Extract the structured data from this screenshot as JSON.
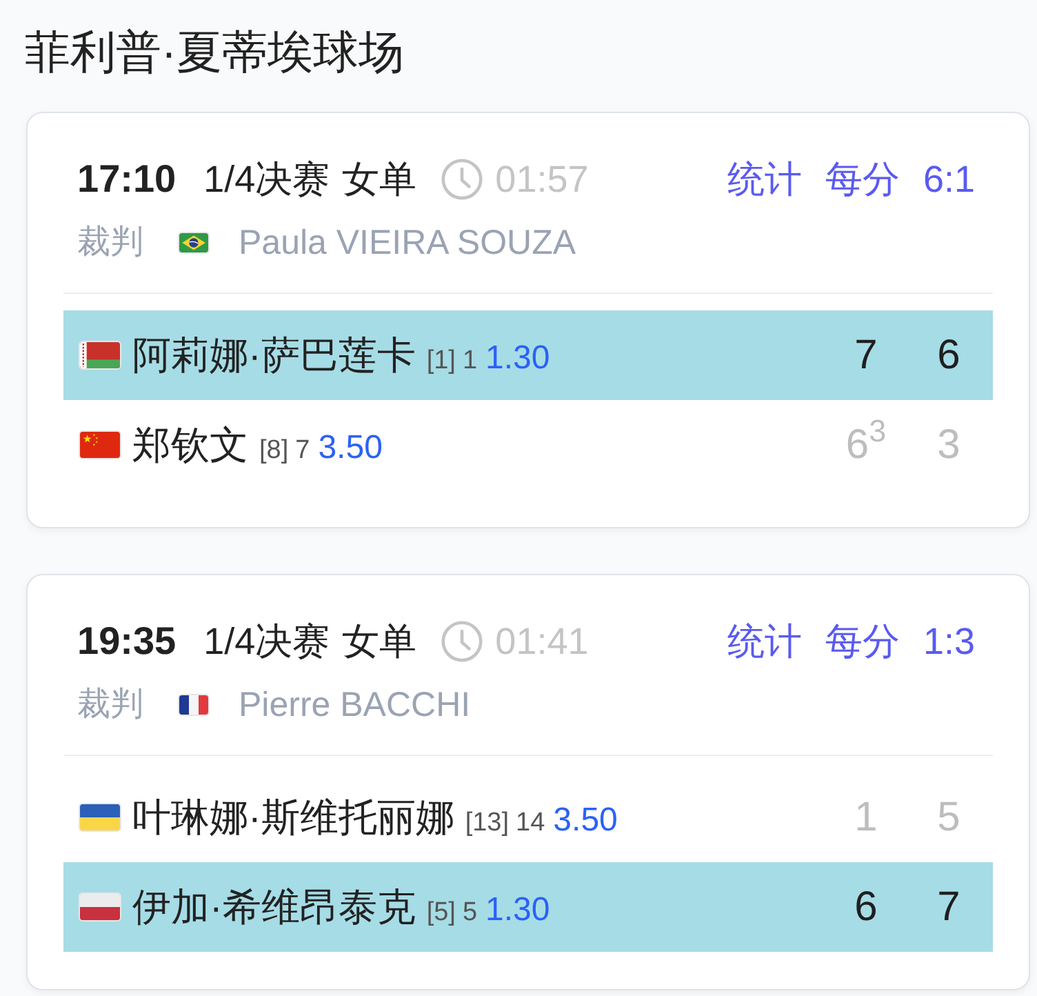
{
  "venue": {
    "title": "菲利普·夏蒂埃球场"
  },
  "matches": [
    {
      "time": "17:10",
      "round": "1/4决赛",
      "event": "女单",
      "duration": "01:57",
      "links": [
        "统计",
        "每分"
      ],
      "head_to_head": "6:1",
      "referee": {
        "label": "裁判",
        "flag": {
          "kind": "brazil"
        },
        "name": "Paula VIEIRA SOUZA"
      },
      "players": [
        {
          "flag": {
            "kind": "belarus"
          },
          "name": "阿莉娜·萨巴莲卡",
          "seed": "[1]",
          "rank": "1",
          "odds": "1.30",
          "scores": [
            "7",
            "6"
          ],
          "winner": true
        },
        {
          "flag": {
            "kind": "china"
          },
          "name": "郑钦文",
          "seed": "[8]",
          "rank": "7",
          "odds": "3.50",
          "scores": [
            "6$^{3}$",
            "3"
          ],
          "winner": false
        }
      ]
    },
    {
      "time": "19:35",
      "round": "1/4决赛",
      "event": "女单",
      "duration": "01:41",
      "links": [
        "统计",
        "每分"
      ],
      "head_to_head": "1:3",
      "referee": {
        "label": "裁判",
        "flag": {
          "kind": "france"
        },
        "name": "Pierre BACCHI"
      },
      "players": [
        {
          "flag": {
            "kind": "ukraine"
          },
          "name": "叶琳娜·斯维托丽娜",
          "seed": "[13]",
          "rank": "14",
          "odds": "3.50",
          "scores": [
            "1",
            "5"
          ],
          "winner": false
        },
        {
          "flag": {
            "kind": "poland"
          },
          "name": "伊加·希维昂泰克",
          "seed": "[5]",
          "rank": "5",
          "odds": "1.30",
          "scores": [
            "6",
            "7"
          ],
          "winner": true
        }
      ]
    }
  ]
}
